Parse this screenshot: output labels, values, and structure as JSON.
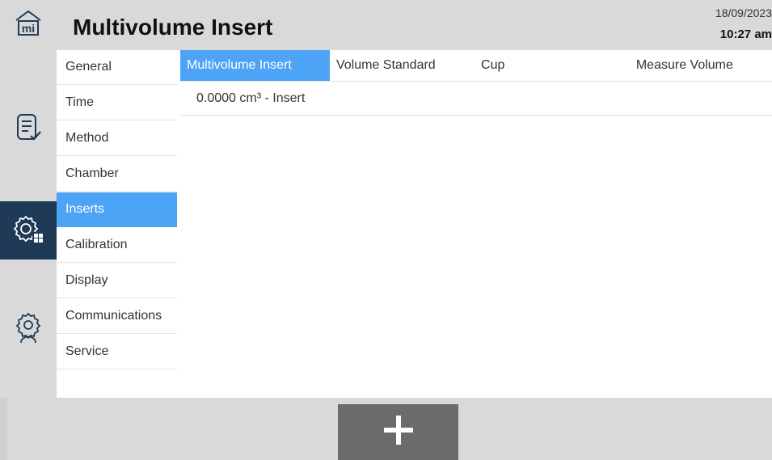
{
  "header": {
    "title": "Multivolume Insert",
    "date": "18/09/2023",
    "time": "10:27 am"
  },
  "rail": {
    "items": [
      {
        "icon": "home-icon"
      },
      {
        "icon": "method-checklist-icon"
      },
      {
        "icon": "settings-grid-icon"
      },
      {
        "icon": "service-user-gear-icon"
      }
    ]
  },
  "subnav": {
    "items": [
      {
        "label": "General"
      },
      {
        "label": "Time"
      },
      {
        "label": "Method"
      },
      {
        "label": "Chamber"
      },
      {
        "label": "Inserts"
      },
      {
        "label": "Calibration"
      },
      {
        "label": "Display"
      },
      {
        "label": "Communications"
      },
      {
        "label": "Service"
      }
    ],
    "active": "Inserts"
  },
  "tabs": {
    "items": [
      {
        "label": "Multivolume Insert"
      },
      {
        "label": "Volume Standard"
      },
      {
        "label": "Cup"
      },
      {
        "label": "Measure Volume"
      }
    ],
    "active": "Multivolume Insert"
  },
  "list": {
    "items": [
      {
        "label": "0.0000 cm³ - Insert"
      }
    ]
  },
  "footer": {
    "add_icon": "plus-icon"
  },
  "colors": {
    "accent": "#4da3f5",
    "rail_active": "#1e3a57",
    "chrome": "#d9d9d9",
    "button": "#6b6b6b"
  }
}
